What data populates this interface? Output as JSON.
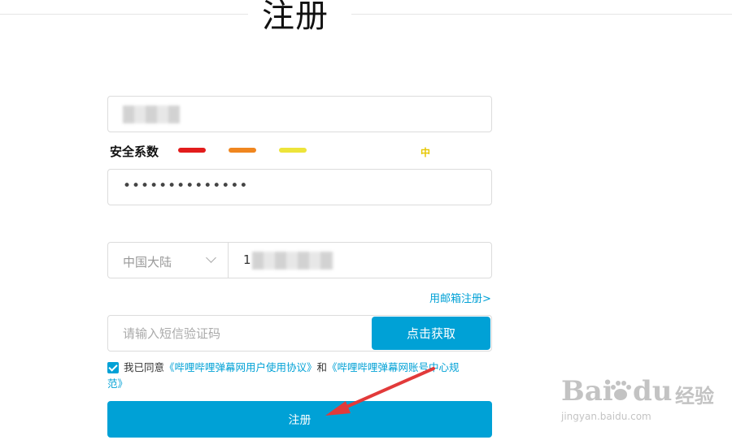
{
  "page": {
    "title": "注册"
  },
  "username": {
    "value_obscured": true
  },
  "strength": {
    "label": "安全系数",
    "level": "中",
    "colors": [
      "#e21c1c",
      "#f0861f",
      "#ede43a"
    ],
    "level_color": "#e6c600"
  },
  "password": {
    "masked_value": "••••••••••••••"
  },
  "phone": {
    "region": "中国大陆",
    "prefix": "1"
  },
  "email_register_link": "用邮箱注册>",
  "sms": {
    "placeholder": "请输入短信验证码",
    "get_code_label": "点击获取"
  },
  "agreement": {
    "checked": true,
    "prefix": "我已同意",
    "link1": "《哔哩哔哩弹幕网用户使用协议》",
    "and": "和",
    "link2": "《哔哩哔哩弹幕网账号中心规",
    "link2_cont": "范》"
  },
  "register_label": "注册",
  "watermark": {
    "brand": "Bai",
    "brand2": "du",
    "cn": "经验",
    "url": "jingyan.baidu.com"
  },
  "colors": {
    "accent": "#00a1d6"
  }
}
